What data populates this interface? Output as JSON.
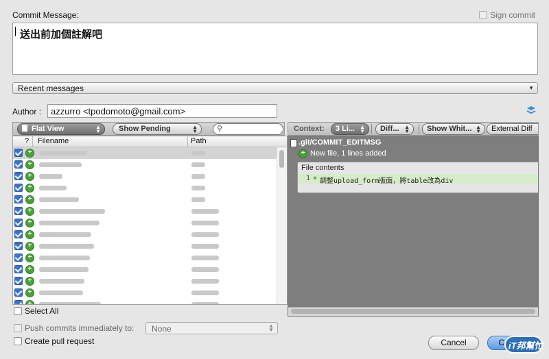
{
  "top": {
    "commit_message_label": "Commit Message:",
    "sign_commit_label": "Sign commit",
    "message_text": "送出前加個註解吧",
    "recent_messages": "Recent messages",
    "author_label": "Author :",
    "author_value": "azzurro <tpodomoto@gmail.com>"
  },
  "left_toolbar": {
    "flat_view": "Flat View",
    "show_pending": "Show Pending",
    "search_placeholder": ""
  },
  "file_table": {
    "columns": [
      "?",
      "Filename",
      "Path"
    ],
    "row_count": 14
  },
  "right_toolbar": {
    "context_label": "Context:",
    "context_value": "3 Li...",
    "diff_value": "Diff...",
    "whitespace_value": "Show Whit...",
    "external_diff": "External Diff"
  },
  "diff": {
    "file_name": ".git/COMMIT_EDITMSG",
    "status": "New file, 1 lines added",
    "contents_label": "File contents",
    "line_number": "1",
    "line_sign": "+",
    "line_text": "調整upload_form版面，將table改為div"
  },
  "bottom": {
    "select_all": "Select All",
    "push_label": "Push commits immediately to:",
    "push_value": "None",
    "pull_request": "Create pull request",
    "cancel": "Cancel",
    "commit": "Commit"
  },
  "watermark": "iT邦幫忙",
  "colors": {
    "diff_background": "#7e7e7e",
    "added_line": "#d6ecc8",
    "accent": "#3b73c9"
  }
}
